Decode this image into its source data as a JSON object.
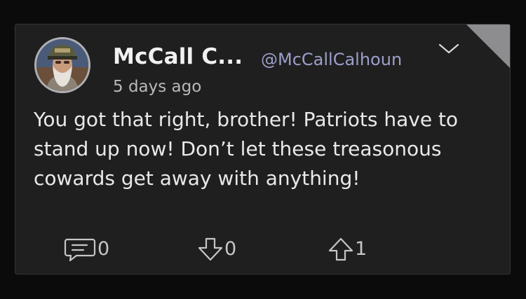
{
  "post": {
    "display_name": "McCall C...",
    "handle": "@McCallCalhoun",
    "timestamp": "5 days ago",
    "body": "You got that right, brother! Patriots have to stand up now! Don’t let these treasonous cowards get away with anything!",
    "avatar_icon": "profile-photo-icon",
    "menu_icon": "chevron-down-icon"
  },
  "actions": {
    "comments": {
      "icon": "comment-icon",
      "count": "0"
    },
    "downvotes": {
      "icon": "arrow-down-icon",
      "count": "0"
    },
    "upvotes": {
      "icon": "arrow-up-icon",
      "count": "1"
    }
  },
  "colors": {
    "background": "#0b0b0b",
    "card": "#1f1f20",
    "handle": "#9c9fc8",
    "text": "#e9e9e9"
  }
}
